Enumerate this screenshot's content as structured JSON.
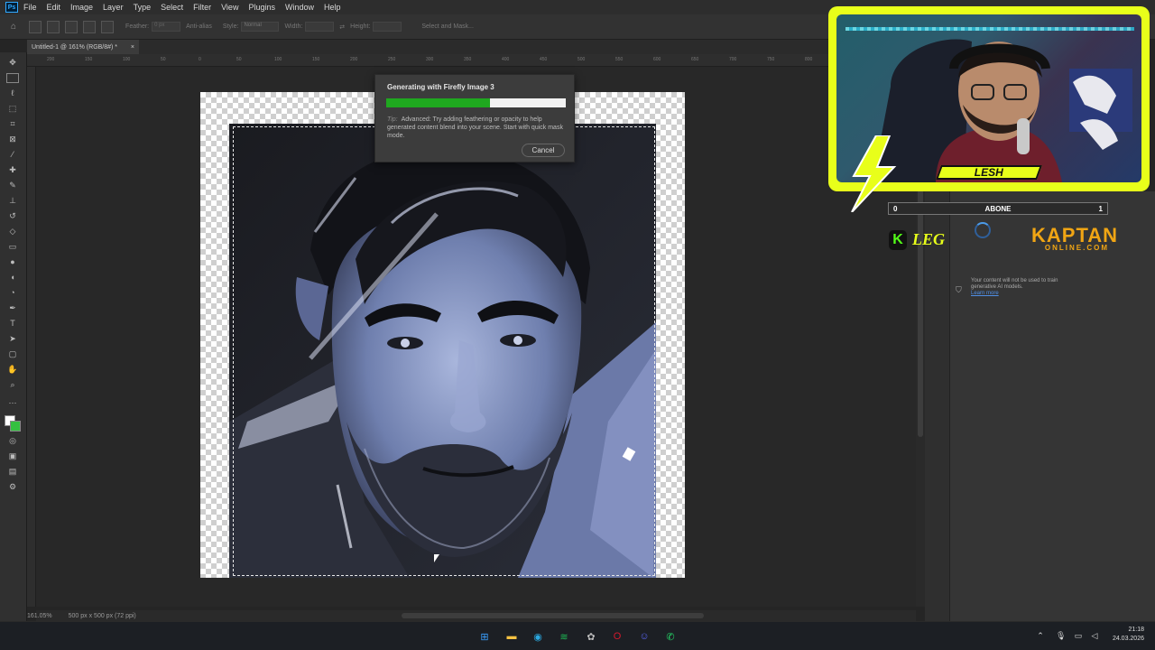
{
  "menubar": {
    "logo": "Ps",
    "items": [
      "File",
      "Edit",
      "Image",
      "Layer",
      "Type",
      "Select",
      "Filter",
      "View",
      "Plugins",
      "Window",
      "Help"
    ]
  },
  "options": {
    "feather_label": "Feather:",
    "feather_value": "0 px",
    "antialias_label": "Anti-alias",
    "style_label": "Style:",
    "style_value": "Normal",
    "width_label": "Width:",
    "height_label": "Height:",
    "select_mask_label": "Select and Mask..."
  },
  "document_tab": {
    "title": "Untitled-1 @ 161% (RGB/8#) *",
    "close": "×"
  },
  "ruler_ticks": [
    "200",
    "150",
    "100",
    "50",
    "0",
    "50",
    "100",
    "150",
    "200",
    "250",
    "300",
    "350",
    "400",
    "450",
    "500",
    "550",
    "600",
    "650",
    "700",
    "750",
    "800"
  ],
  "status": {
    "zoom": "161.05%",
    "doc_size": "500 px x 500 px (72 ppi)"
  },
  "dialog": {
    "title": "Generating with Firefly Image 3",
    "progress": 0.58,
    "tip_label": "Tip:",
    "tip_text": "Advanced: Try adding feathering or opacity to help generated content blend into your scene. Start with quick mask mode.",
    "cancel": "Cancel"
  },
  "panel": {
    "privacy_text": "Your content will not be used to train generative AI models.",
    "learn_more": "Learn more"
  },
  "overlay": {
    "streamer_name": "LESH",
    "sub_label": "ABONE",
    "sub_current": "0",
    "sub_goal": "1",
    "kick_logo": "K",
    "leg_text": "LEG",
    "sponsor_main": "KAPTAN",
    "sponsor_sub": "ONLINE.COM"
  },
  "taskbar": {
    "apps": [
      {
        "name": "windows-start-icon",
        "glyph": "⊞",
        "color": "#3aa0ff"
      },
      {
        "name": "file-explorer-icon",
        "glyph": "▬",
        "color": "#f5c242"
      },
      {
        "name": "edge-browser-icon",
        "glyph": "◉",
        "color": "#2ba8e0"
      },
      {
        "name": "spotify-icon",
        "glyph": "≋",
        "color": "#1db954"
      },
      {
        "name": "chatgpt-icon",
        "glyph": "✿",
        "color": "#bbbbbb"
      },
      {
        "name": "opera-icon",
        "glyph": "O",
        "color": "#d4192c"
      },
      {
        "name": "discord-icon",
        "glyph": "☺",
        "color": "#5865f2"
      },
      {
        "name": "whatsapp-icon",
        "glyph": "✆",
        "color": "#25d366"
      }
    ],
    "time": "21:18",
    "date": "24.03.2026"
  }
}
